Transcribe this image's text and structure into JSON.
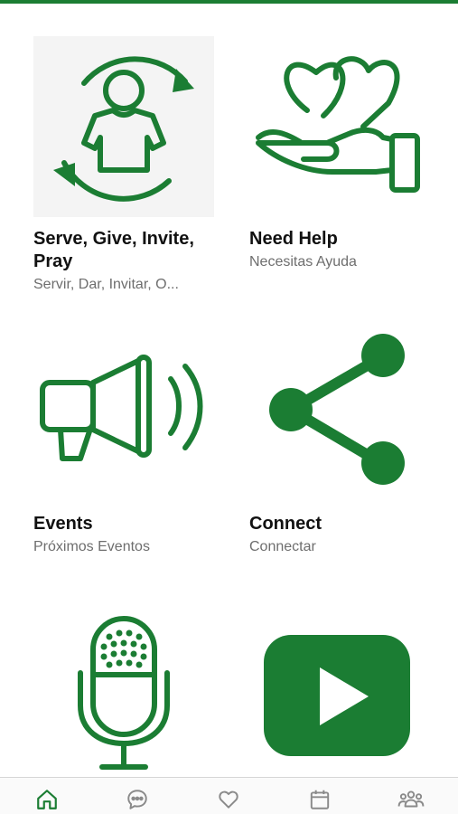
{
  "colors": {
    "accent": "#1b7d33",
    "nav_inactive": "#8a8a8a",
    "nav_active": "#1b7d33"
  },
  "tiles": [
    {
      "title": "Serve, Give, Invite, Pray",
      "subtitle": "Servir, Dar, Invitar, O...",
      "icon": "person-cycle-icon"
    },
    {
      "title": "Need Help",
      "subtitle": "Necesitas Ayuda",
      "icon": "hand-hearts-icon"
    },
    {
      "title": "Events",
      "subtitle": "Próximos Eventos",
      "icon": "megaphone-icon"
    },
    {
      "title": "Connect",
      "subtitle": "Connectar",
      "icon": "share-icon"
    },
    {
      "title": "",
      "subtitle": "",
      "icon": "microphone-icon"
    },
    {
      "title": "",
      "subtitle": "",
      "icon": "play-video-icon"
    }
  ],
  "bottom_nav": [
    {
      "icon": "home-icon",
      "active": true
    },
    {
      "icon": "chat-icon",
      "active": false
    },
    {
      "icon": "heart-icon",
      "active": false
    },
    {
      "icon": "calendar-icon",
      "active": false
    },
    {
      "icon": "community-icon",
      "active": false
    }
  ]
}
